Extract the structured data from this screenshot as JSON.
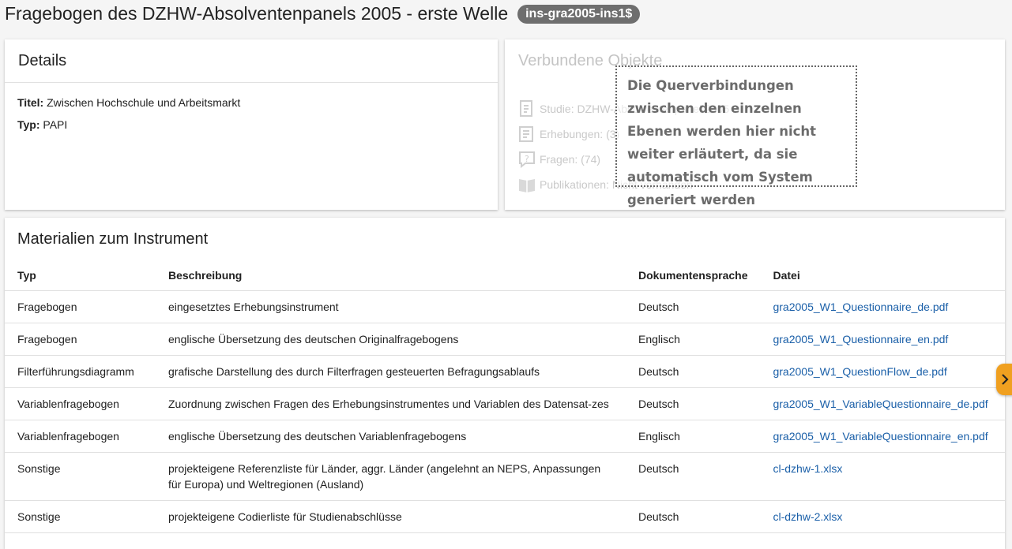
{
  "page": {
    "title": "Fragebogen des DZHW-Absolventenpanels 2005 - erste Welle",
    "id_badge": "ins-gra2005-ins1$"
  },
  "details": {
    "header": "Details",
    "title_label": "Titel:",
    "title_value": "Zwischen Hochschule und Arbeitsmarkt",
    "type_label": "Typ:",
    "type_value": "PAPI"
  },
  "linked": {
    "header": "Verbundene Objekte",
    "items": [
      {
        "label": "Studie: DZHW-Absolventenpanel 2005",
        "icon": "study-icon"
      },
      {
        "label": "Erhebungen: (3)",
        "icon": "survey-icon"
      },
      {
        "label": "Fragen: (74)",
        "icon": "question-icon"
      },
      {
        "label": "Publikationen: Nicht vorhanden",
        "icon": "book-icon"
      }
    ]
  },
  "callout": {
    "text": "Die Querverbindungen zwischen den einzelnen Ebenen werden hier nicht weiter erläutert, da sie automatisch vom System generiert werden"
  },
  "materials": {
    "header": "Materialien zum Instrument",
    "columns": [
      "Typ",
      "Beschreibung",
      "Dokumentensprache",
      "Datei"
    ],
    "rows": [
      {
        "typ": "Fragebogen",
        "desc": "eingesetztes Erhebungsinstrument",
        "lang": "Deutsch",
        "file": "gra2005_W1_Questionnaire_de.pdf"
      },
      {
        "typ": "Fragebogen",
        "desc": "englische Übersetzung des deutschen Originalfragebogens",
        "lang": "Englisch",
        "file": "gra2005_W1_Questionnaire_en.pdf"
      },
      {
        "typ": "Filterführungsdiagramm",
        "desc": "grafische Darstellung des durch Filterfragen gesteuerten Befragungsablaufs",
        "lang": "Deutsch",
        "file": "gra2005_W1_QuestionFlow_de.pdf"
      },
      {
        "typ": "Variablenfragebogen",
        "desc": "Zuordnung zwischen Fragen des Erhebungsinstrumentes und Variablen des Datensat-zes",
        "lang": "Deutsch",
        "file": "gra2005_W1_VariableQuestionnaire_de.pdf"
      },
      {
        "typ": "Variablenfragebogen",
        "desc": "englische Übersetzung des deutschen Variablenfragebogens",
        "lang": "Englisch",
        "file": "gra2005_W1_VariableQuestionnaire_en.pdf"
      },
      {
        "typ": "Sonstige",
        "desc": "projekteigene Referenzliste für Länder, aggr. Länder (angelehnt an NEPS, Anpassungen für Europa) und Weltregionen (Ausland)",
        "lang": "Deutsch",
        "file": "cl-dzhw-1.xlsx"
      },
      {
        "typ": "Sonstige",
        "desc": "projekteigene Codierliste für Studienabschlüsse",
        "lang": "Deutsch",
        "file": "cl-dzhw-2.xlsx"
      }
    ]
  },
  "colors": {
    "badge": "#6e6e6e",
    "link": "#1a5fa8",
    "side_tab": "#f0a020"
  }
}
